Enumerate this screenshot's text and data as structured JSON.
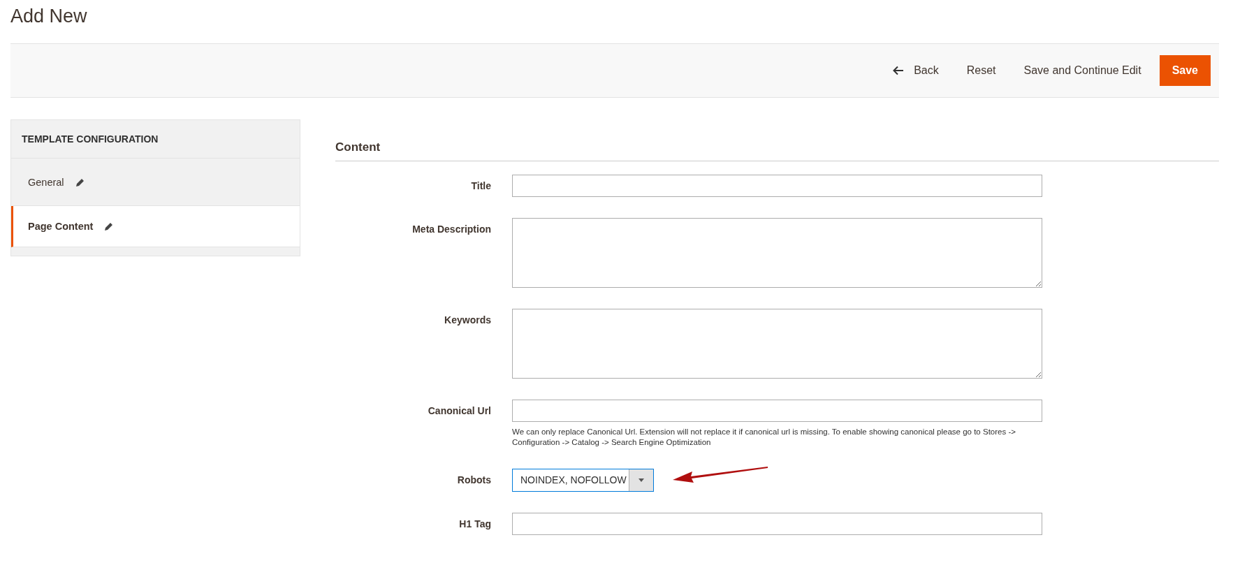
{
  "page_title": "Add New",
  "toolbar": {
    "back": "Back",
    "reset": "Reset",
    "save_continue": "Save and Continue Edit",
    "save": "Save"
  },
  "sidebar": {
    "title": "TEMPLATE CONFIGURATION",
    "items": [
      {
        "label": "General",
        "selected": false
      },
      {
        "label": "Page Content",
        "selected": true
      }
    ]
  },
  "section": {
    "title": "Content",
    "fields": [
      {
        "kind": "input",
        "label": "Title"
      },
      {
        "kind": "textarea",
        "label": "Meta Description"
      },
      {
        "kind": "textarea",
        "label": "Keywords"
      },
      {
        "kind": "input",
        "label": "Canonical Url",
        "note": "We can only replace Canonical Url. Extension will not replace it if canonical url is missing. To enable showing canonical please go to Stores -> Configuration -> Catalog -> Search Engine Optimization"
      },
      {
        "kind": "select",
        "label": "Robots",
        "value": "NOINDEX, NOFOLLOW",
        "annotated": true
      },
      {
        "kind": "input",
        "label": "H1 Tag"
      }
    ]
  }
}
